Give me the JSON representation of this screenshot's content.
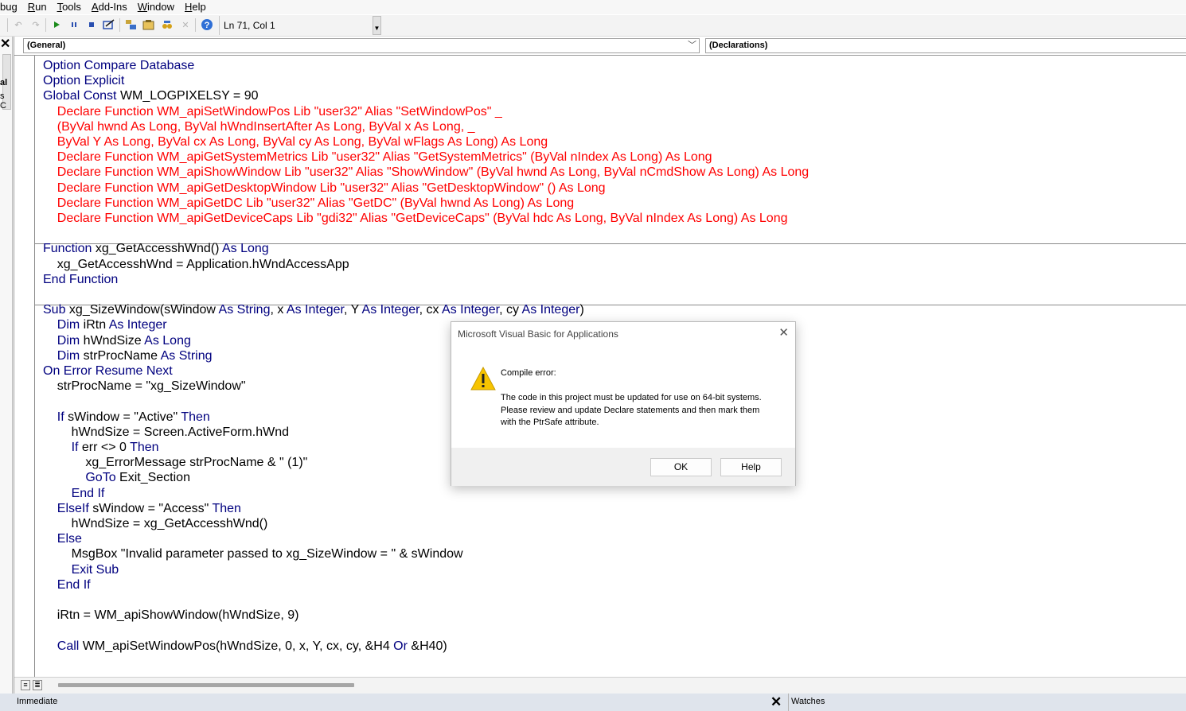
{
  "menu": {
    "items": [
      {
        "label": "bug",
        "accel": ""
      },
      {
        "label": "Run",
        "accel": "R"
      },
      {
        "label": "Tools",
        "accel": "T"
      },
      {
        "label": "Add-Ins",
        "accel": "A"
      },
      {
        "label": "Window",
        "accel": "W"
      },
      {
        "label": "Help",
        "accel": "H"
      }
    ]
  },
  "toolbar": {
    "cursor_position": "Ln 71, Col 1"
  },
  "left_panel": {
    "fragments": [
      "al",
      "s C"
    ]
  },
  "code_window": {
    "object_combo": "(General)",
    "procedure_combo": "(Declarations)",
    "lines": [
      [
        {
          "t": "kw",
          "s": "Option Compare Database"
        }
      ],
      [
        {
          "t": "kw",
          "s": "Option Explicit"
        }
      ],
      [
        {
          "t": "kw",
          "s": "Global Const "
        },
        {
          "t": "pl",
          "s": "WM_LOGPIXELSY = 90"
        }
      ],
      [
        {
          "t": "err",
          "s": "    Declare Function WM_apiSetWindowPos Lib \"user32\" Alias \"SetWindowPos\" _"
        }
      ],
      [
        {
          "t": "err",
          "s": "    (ByVal hwnd As Long, ByVal hWndInsertAfter As Long, ByVal x As Long, _"
        }
      ],
      [
        {
          "t": "err",
          "s": "    ByVal Y As Long, ByVal cx As Long, ByVal cy As Long, ByVal wFlags As Long) As Long"
        }
      ],
      [
        {
          "t": "err",
          "s": "    Declare Function WM_apiGetSystemMetrics Lib \"user32\" Alias \"GetSystemMetrics\" (ByVal nIndex As Long) As Long"
        }
      ],
      [
        {
          "t": "err",
          "s": "    Declare Function WM_apiShowWindow Lib \"user32\" Alias \"ShowWindow\" (ByVal hwnd As Long, ByVal nCmdShow As Long) As Long"
        }
      ],
      [
        {
          "t": "err",
          "s": "    Declare Function WM_apiGetDesktopWindow Lib \"user32\" Alias \"GetDesktopWindow\" () As Long"
        }
      ],
      [
        {
          "t": "err",
          "s": "    Declare Function WM_apiGetDC Lib \"user32\" Alias \"GetDC\" (ByVal hwnd As Long) As Long"
        }
      ],
      [
        {
          "t": "err",
          "s": "    Declare Function WM_apiGetDeviceCaps Lib \"gdi32\" Alias \"GetDeviceCaps\" (ByVal hdc As Long, ByVal nIndex As Long) As Long"
        }
      ],
      [],
      [
        {
          "t": "kw",
          "s": "Function "
        },
        {
          "t": "pl",
          "s": "xg_GetAccesshWnd() "
        },
        {
          "t": "kw",
          "s": "As Long"
        }
      ],
      [
        {
          "t": "pl",
          "s": "    xg_GetAccesshWnd = Application.hWndAccessApp"
        }
      ],
      [
        {
          "t": "kw",
          "s": "End Function"
        }
      ],
      [],
      [
        {
          "t": "kw",
          "s": "Sub "
        },
        {
          "t": "pl",
          "s": "xg_SizeWindow(sWindow "
        },
        {
          "t": "kw",
          "s": "As String"
        },
        {
          "t": "pl",
          "s": ", x "
        },
        {
          "t": "kw",
          "s": "As Integer"
        },
        {
          "t": "pl",
          "s": ", Y "
        },
        {
          "t": "kw",
          "s": "As Integer"
        },
        {
          "t": "pl",
          "s": ", cx "
        },
        {
          "t": "kw",
          "s": "As Integer"
        },
        {
          "t": "pl",
          "s": ", cy "
        },
        {
          "t": "kw",
          "s": "As Integer"
        },
        {
          "t": "pl",
          "s": ")"
        }
      ],
      [
        {
          "t": "kw",
          "s": "    Dim "
        },
        {
          "t": "pl",
          "s": "iRtn "
        },
        {
          "t": "kw",
          "s": "As Integer"
        }
      ],
      [
        {
          "t": "kw",
          "s": "    Dim "
        },
        {
          "t": "pl",
          "s": "hWndSize "
        },
        {
          "t": "kw",
          "s": "As Long"
        }
      ],
      [
        {
          "t": "kw",
          "s": "    Dim "
        },
        {
          "t": "pl",
          "s": "strProcName "
        },
        {
          "t": "kw",
          "s": "As String"
        }
      ],
      [
        {
          "t": "kw",
          "s": "On Error Resume Next"
        }
      ],
      [
        {
          "t": "pl",
          "s": "    strProcName = \"xg_SizeWindow\""
        }
      ],
      [],
      [
        {
          "t": "kw",
          "s": "    If "
        },
        {
          "t": "pl",
          "s": "sWindow = \"Active\" "
        },
        {
          "t": "kw",
          "s": "Then"
        }
      ],
      [
        {
          "t": "pl",
          "s": "        hWndSize = Screen.ActiveForm.hWnd"
        }
      ],
      [
        {
          "t": "kw",
          "s": "        If "
        },
        {
          "t": "pl",
          "s": "err <> 0 "
        },
        {
          "t": "kw",
          "s": "Then"
        }
      ],
      [
        {
          "t": "pl",
          "s": "            xg_ErrorMessage strProcName & \" (1)\""
        }
      ],
      [
        {
          "t": "kw",
          "s": "            GoTo "
        },
        {
          "t": "pl",
          "s": "Exit_Section"
        }
      ],
      [
        {
          "t": "kw",
          "s": "        End If"
        }
      ],
      [
        {
          "t": "kw",
          "s": "    ElseIf "
        },
        {
          "t": "pl",
          "s": "sWindow = \"Access\" "
        },
        {
          "t": "kw",
          "s": "Then"
        }
      ],
      [
        {
          "t": "pl",
          "s": "        hWndSize = xg_GetAccesshWnd()"
        }
      ],
      [
        {
          "t": "kw",
          "s": "    Else"
        }
      ],
      [
        {
          "t": "pl",
          "s": "        MsgBox \"Invalid parameter passed to xg_SizeWindow = \" & sWindow"
        }
      ],
      [
        {
          "t": "kw",
          "s": "        Exit Sub"
        }
      ],
      [
        {
          "t": "kw",
          "s": "    End If"
        }
      ],
      [],
      [
        {
          "t": "pl",
          "s": "    iRtn = WM_apiShowWindow(hWndSize, 9)"
        }
      ],
      [],
      [
        {
          "t": "kw",
          "s": "    Call "
        },
        {
          "t": "pl",
          "s": "WM_apiSetWindowPos(hWndSize, 0, x, Y, cx, cy, &H4 "
        },
        {
          "t": "kw",
          "s": "Or "
        },
        {
          "t": "pl",
          "s": "&H40)"
        }
      ]
    ]
  },
  "bottom": {
    "immediate_label": "Immediate",
    "watches_label": "Watches"
  },
  "dialog": {
    "title": "Microsoft Visual Basic for Applications",
    "heading": "Compile error:",
    "body": "The code in this project must be updated for use on 64-bit systems. Please review and update Declare statements and then mark them with the PtrSafe attribute.",
    "ok_label": "OK",
    "help_label": "Help"
  },
  "colors": {
    "keyword": "#00007f",
    "error_text": "#ff0000",
    "plain": "#000000",
    "warning": "#f7c400"
  }
}
